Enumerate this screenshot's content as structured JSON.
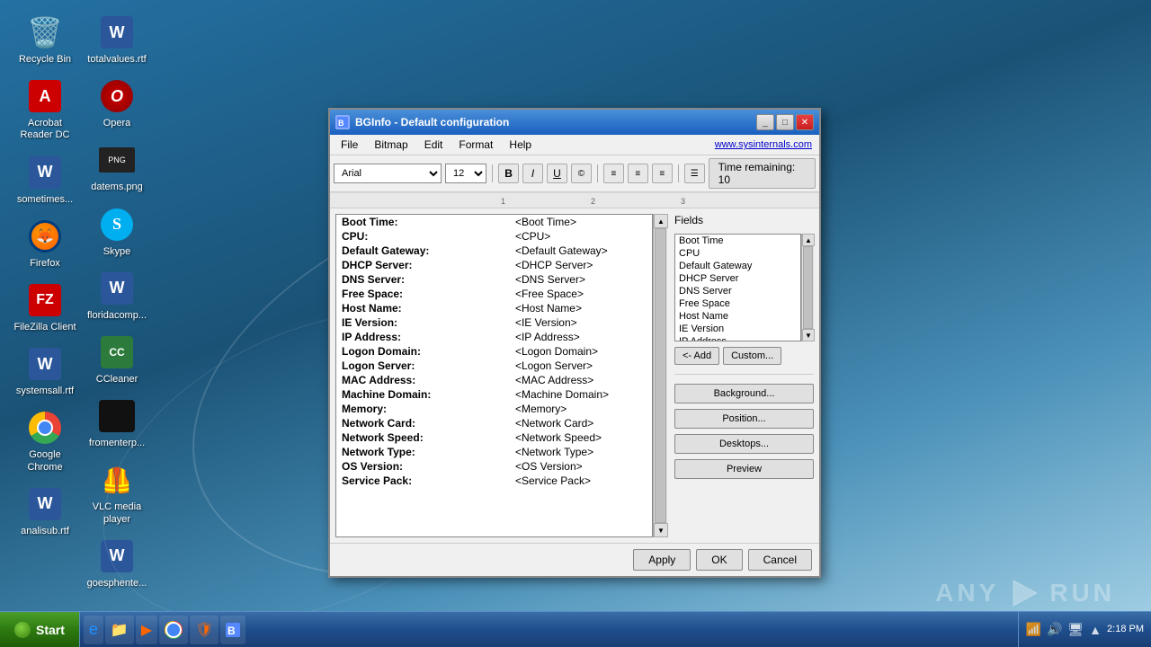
{
  "desktop": {
    "icons": [
      {
        "id": "recycle-bin",
        "label": "Recycle Bin",
        "type": "recycle"
      },
      {
        "id": "acrobat",
        "label": "Acrobat Reader DC",
        "type": "acrobat"
      },
      {
        "id": "sometimes-rtf",
        "label": "sometimes...",
        "type": "word"
      },
      {
        "id": "firefox",
        "label": "Firefox",
        "type": "firefox"
      },
      {
        "id": "filezilla",
        "label": "FileZilla Client",
        "type": "filezilla"
      },
      {
        "id": "systemsall-rtf",
        "label": "systemsall.rtf",
        "type": "word"
      },
      {
        "id": "chrome",
        "label": "Google Chrome",
        "type": "chrome"
      },
      {
        "id": "analisub-rtf",
        "label": "analisub.rtf",
        "type": "word"
      },
      {
        "id": "totalvalues-rtf",
        "label": "totalvalues.rtf",
        "type": "word"
      },
      {
        "id": "opera",
        "label": "Opera",
        "type": "opera"
      },
      {
        "id": "datems-png",
        "label": "datems.png",
        "type": "png"
      },
      {
        "id": "skype",
        "label": "Skype",
        "type": "skype"
      },
      {
        "id": "floridacomp",
        "label": "floridacomp...",
        "type": "word"
      },
      {
        "id": "ccleaner",
        "label": "CCleaner",
        "type": "cc"
      },
      {
        "id": "fromenterp",
        "label": "fromenterp...",
        "type": "black"
      },
      {
        "id": "vlc",
        "label": "VLC media player",
        "type": "vlc"
      },
      {
        "id": "goesphente",
        "label": "goesphente...",
        "type": "word"
      }
    ]
  },
  "taskbar": {
    "start_label": "Start",
    "items": [
      {
        "id": "ie-icon",
        "type": "ie"
      },
      {
        "id": "folder-icon",
        "type": "folder"
      },
      {
        "id": "media-icon",
        "type": "media"
      },
      {
        "id": "chrome-taskbar",
        "type": "chrome"
      },
      {
        "id": "avast-taskbar",
        "type": "avast"
      },
      {
        "id": "bginfo-taskbar",
        "type": "bginfo"
      }
    ],
    "tray": {
      "time": "2:18 PM"
    }
  },
  "bginfo": {
    "title": "BGInfo - Default configuration",
    "sysinternals_url": "www.sysinternals.com",
    "menus": [
      "File",
      "Bitmap",
      "Edit",
      "Format",
      "Help"
    ],
    "font": "Arial",
    "size": "12",
    "time_remaining_label": "Time remaining:",
    "time_remaining_value": "10",
    "fields_label": "Fields",
    "fields_list": [
      "Boot Time",
      "CPU",
      "Default Gateway",
      "DHCP Server",
      "DNS Server",
      "Free Space",
      "Host Name",
      "IE Version",
      "IP Address"
    ],
    "btn_add": "<- Add",
    "btn_custom": "Custom...",
    "btn_background": "Background...",
    "btn_position": "Position...",
    "btn_desktops": "Desktops...",
    "btn_preview": "Preview",
    "btn_apply": "Apply",
    "btn_ok": "OK",
    "btn_cancel": "Cancel",
    "rows": [
      {
        "label": "Boot Time:",
        "value": "<Boot Time>"
      },
      {
        "label": "CPU:",
        "value": "<CPU>"
      },
      {
        "label": "Default Gateway:",
        "value": "<Default Gateway>"
      },
      {
        "label": "DHCP Server:",
        "value": "<DHCP Server>"
      },
      {
        "label": "DNS Server:",
        "value": "<DNS Server>"
      },
      {
        "label": "Free Space:",
        "value": "<Free Space>"
      },
      {
        "label": "Host Name:",
        "value": "<Host Name>"
      },
      {
        "label": "IE Version:",
        "value": "<IE Version>"
      },
      {
        "label": "IP Address:",
        "value": "<IP Address>"
      },
      {
        "label": "Logon Domain:",
        "value": "<Logon Domain>"
      },
      {
        "label": "Logon Server:",
        "value": "<Logon Server>"
      },
      {
        "label": "MAC Address:",
        "value": "<MAC Address>"
      },
      {
        "label": "Machine Domain:",
        "value": "<Machine Domain>"
      },
      {
        "label": "Memory:",
        "value": "<Memory>"
      },
      {
        "label": "Network Card:",
        "value": "<Network Card>"
      },
      {
        "label": "Network Speed:",
        "value": "<Network Speed>"
      },
      {
        "label": "Network Type:",
        "value": "<Network Type>"
      },
      {
        "label": "OS Version:",
        "value": "<OS Version>"
      },
      {
        "label": "Service Pack:",
        "value": "<Service Pack>"
      }
    ]
  }
}
